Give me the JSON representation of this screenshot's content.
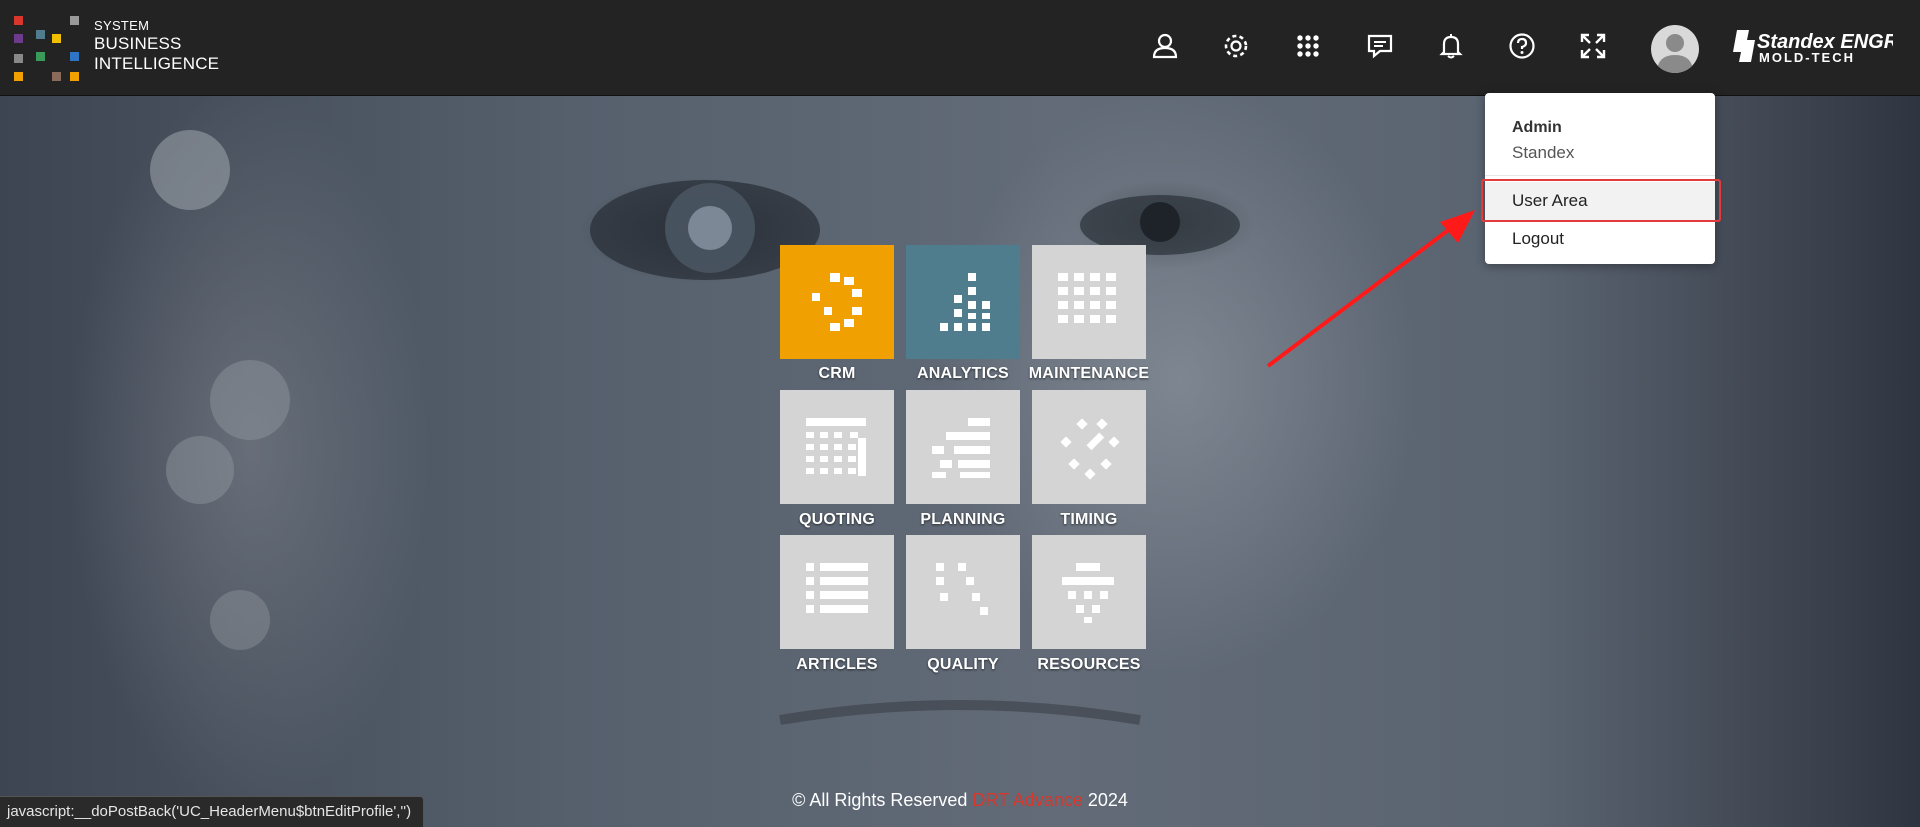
{
  "header": {
    "brand_small": "SYSTEM",
    "brand_line1": "BUSINESS",
    "brand_line2": "INTELLIGENCE",
    "icons": [
      "user-icon",
      "gear-icon",
      "apps-grid-icon",
      "chat-icon",
      "bell-icon",
      "help-icon",
      "fullscreen-icon"
    ],
    "company_logo_line1": "Standex ENGRAVING",
    "company_logo_line2": "MOLD-TECH"
  },
  "user_menu": {
    "name": "Admin",
    "company": "Standex",
    "items": [
      "User Area",
      "Logout"
    ]
  },
  "modules": [
    {
      "label": "CRM",
      "color": "#f0a000"
    },
    {
      "label": "ANALYTICS",
      "color": "#4f7d8e"
    },
    {
      "label": "MAINTENANCE",
      "color": "#d4d4d4"
    },
    {
      "label": "QUOTING",
      "color": "#d4d4d4"
    },
    {
      "label": "PLANNING",
      "color": "#d4d4d4"
    },
    {
      "label": "TIMING",
      "color": "#d4d4d4"
    },
    {
      "label": "ARTICLES",
      "color": "#d4d4d4"
    },
    {
      "label": "QUALITY",
      "color": "#d4d4d4"
    },
    {
      "label": "RESOURCES",
      "color": "#d4d4d4"
    }
  ],
  "footer": {
    "prefix": "© All Rights Reserved",
    "brand": "DRT Advance",
    "year": "2024"
  },
  "status_bar": "javascript:__doPostBack('UC_HeaderMenu$btnEditProfile','')",
  "colors": {
    "header_bg": "#232323",
    "highlight": "#e33b3b",
    "footer_brand": "#d9372b"
  }
}
